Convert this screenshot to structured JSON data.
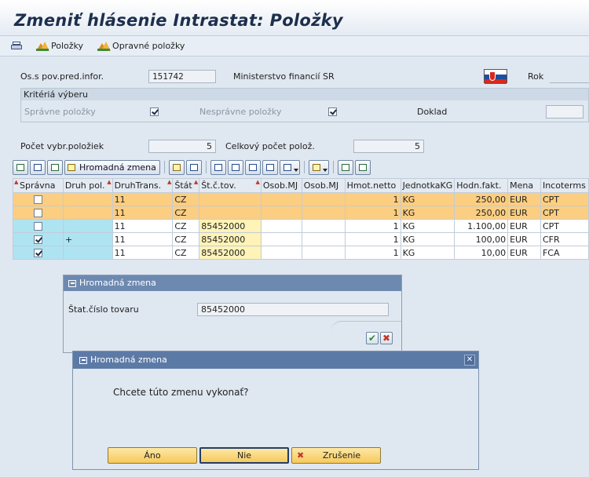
{
  "header": {
    "title": "Zmeniť hlásenie Intrastat: Položky"
  },
  "toolbar": {
    "items": [
      {
        "label": "Položky",
        "icon": "mountain-icon"
      },
      {
        "label": "Opravné položky",
        "icon": "mountain-icon"
      }
    ]
  },
  "form": {
    "os_label": "Os.s pov.pred.infor.",
    "os_value": "151742",
    "ministry": "Ministerstvo financií SR",
    "year_label": "Rok",
    "criteria_label": "Kritériá výberu",
    "correct_label": "Správne položky",
    "incorrect_label": "Nesprávne položky",
    "document_label": "Doklad",
    "selected_count_label": "Počet vybr.položiek",
    "selected_count": "5",
    "total_count_label": "Celkový počet polož.",
    "total_count": "5"
  },
  "alv_toolbar": {
    "mass_change_label": "Hromadná zmena"
  },
  "grid": {
    "columns": [
      "Správna",
      "Druh pol.",
      "DruhTrans.",
      "Štát",
      "Št.č.tov.",
      "Osob.MJ",
      "Osob.MJ",
      "Hmot.netto",
      "JednotkaKG",
      "Hodn.fakt.",
      "Mena",
      "Incoterms"
    ],
    "rows": [
      {
        "ok": false,
        "kind": "",
        "trans": "11",
        "state": "CZ",
        "code": "",
        "mj1": "",
        "mj2": "",
        "net": "1",
        "unit": "KG",
        "value": "250,00",
        "cur": "EUR",
        "inco": "CPT",
        "error": true
      },
      {
        "ok": false,
        "kind": "",
        "trans": "11",
        "state": "CZ",
        "code": "",
        "mj1": "",
        "mj2": "",
        "net": "1",
        "unit": "KG",
        "value": "250,00",
        "cur": "EUR",
        "inco": "CPT",
        "error": true
      },
      {
        "ok": false,
        "kind": "",
        "trans": "11",
        "state": "CZ",
        "code": "85452000",
        "mj1": "",
        "mj2": "",
        "net": "1",
        "unit": "KG",
        "value": "1.100,00",
        "cur": "EUR",
        "inco": "CPT",
        "error": false
      },
      {
        "ok": true,
        "kind": "+",
        "trans": "11",
        "state": "CZ",
        "code": "85452000",
        "mj1": "",
        "mj2": "",
        "net": "1",
        "unit": "KG",
        "value": "100,00",
        "cur": "EUR",
        "inco": "CFR",
        "error": false
      },
      {
        "ok": true,
        "kind": "",
        "trans": "11",
        "state": "CZ",
        "code": "85452000",
        "mj1": "",
        "mj2": "",
        "net": "1",
        "unit": "KG",
        "value": "10,00",
        "cur": "EUR",
        "inco": "FCA",
        "error": false
      }
    ]
  },
  "mass_change_dialog": {
    "title": "Hromadná zmena",
    "field_label": "Štat.číslo tovaru",
    "field_value": "85452000"
  },
  "confirm_dialog": {
    "title": "Hromadná zmena",
    "question": "Chcete túto zmenu vykonať?",
    "yes": "Áno",
    "no": "Nie",
    "cancel": "Zrušenie"
  },
  "colors": {
    "error_row": "#fbce82",
    "key_cell": "#fff3b8",
    "selection": "#aee4f2",
    "header_bar": "#5c7aa6"
  }
}
